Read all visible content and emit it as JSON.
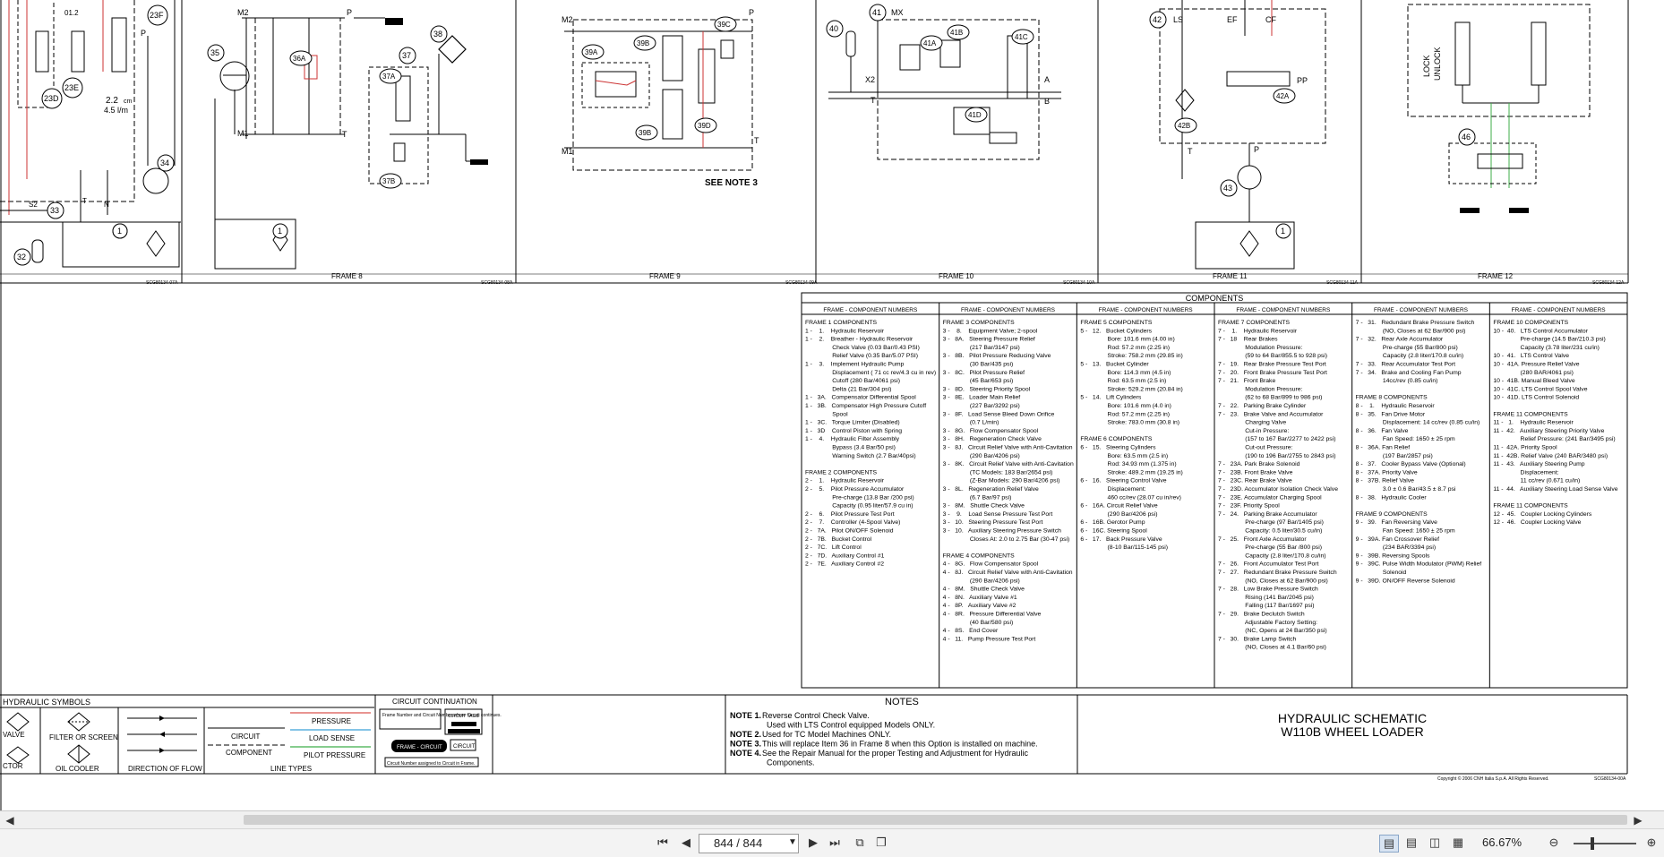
{
  "document": {
    "title_line1": "HYDRAULIC SCHEMATIC",
    "title_line2": "W110B WHEEL LOADER",
    "copyright": "Copyright © 2006 CNH Italia S.p.A. All Rights Reserved.",
    "sheet_code": "SCG80134-00A"
  },
  "frames": [
    {
      "label": "",
      "code": "SCG80134-07A"
    },
    {
      "label": "FRAME 8",
      "code": "SCG80134-08A"
    },
    {
      "label": "FRAME 9",
      "code": "SCG80134-09A"
    },
    {
      "label": "FRAME 10",
      "code": "SCG80134-10A"
    },
    {
      "label": "FRAME 11",
      "code": "SCG80134-11A"
    },
    {
      "label": "FRAME 12",
      "code": "SCG80134-12A"
    }
  ],
  "schematic_labels": {
    "f7": [
      "23F",
      "23E",
      "23D",
      "P",
      "2.2",
      "cm",
      "4.5 l/m",
      "34",
      "33",
      "32",
      "1",
      "S2",
      "T",
      "N",
      "01.2"
    ],
    "f8": [
      "M2",
      "P",
      "36A",
      "35",
      "37",
      "37A",
      "37B",
      "38",
      "M1",
      "T",
      "1"
    ],
    "f9": [
      "M2",
      "39A",
      "39B",
      "39C",
      "39B",
      "39D",
      "M1",
      "P",
      "T",
      "SEE NOTE 3"
    ],
    "f10": [
      "40",
      "41",
      "MX",
      "41A",
      "41B",
      "41C",
      "41D",
      "X2",
      "T",
      "A",
      "B"
    ],
    "f11": [
      "42",
      "LS",
      "EF",
      "CF",
      "42A",
      "42B",
      "PP",
      "T",
      "P",
      "43",
      "1"
    ],
    "f12": [
      "LOCK",
      "UNLOCK",
      "46"
    ]
  },
  "components": {
    "heading": "COMPONENTS",
    "col_header": "FRAME - COMPONENT NUMBERS",
    "columns": [
      [
        "FRAME 1 COMPONENTS",
        "1 -    1.    Hydraulic Reservoir",
        "1 -    2.    Breather - Hydraulic Reservoir",
        "                Check Valve (0.03 Bar/0.43 PSI)",
        "                Relief Valve (0.35 Bar/5.07 PSI)",
        "1 -    3.    Implement Hydraulic Pump",
        "                Displacement ( 71 cc rev/4.3 cu in rev)",
        "                Cutoff (280 Bar/4061 psi)",
        "                Delta (21 Bar/304 psi)",
        "1 -   3A.   Compensator Differential Spool",
        "1 -   3B.   Compensator High Pressure Cutoff",
        "                Spool",
        "1 -   3C.   Torque Limiter (Disabled)",
        "1 -   3D    Control Piston with Spring",
        "1 -    4.    Hydraulic Filter Assembly",
        "                Bypass (3.4 Bar/50 psi)",
        "                Warning Switch (2.7 Bar/40psi)",
        "",
        "FRAME 2 COMPONENTS",
        "2 -    1.    Hydraulic Reservoir",
        "2 -    5.    Pilot Pressure Accumulator",
        "                Pre-charge (13.8 Bar /200 psi)",
        "                Capacity (0.95 liter/57.9 cu in)",
        "2 -    6.    Pilot Pressure Test Port",
        "2 -    7.    Controller (4-Spool Valve)",
        "2 -   7A.   Pilot ON/OFF Solenoid",
        "2 -   7B.   Bucket Control",
        "2 -   7C.   Lift Control",
        "2 -   7D.   Auxiliary Control #1",
        "2 -   7E.   Auxiliary Control #2"
      ],
      [
        "FRAME 3 COMPONENTS",
        "3 -    8.    Equipment Valve; 2-spool",
        "3 -   8A.   Steering Pressure Relief",
        "                (217 Bar/3147 psi)",
        "3 -   8B.   Pilot Pressure Reducing Valve",
        "                (30 Bar/435 psi)",
        "3 -   8C.   Pilot Pressure Relief",
        "                (45 Bar/653 psi)",
        "3 -   8D.   Steering Priority Spool",
        "3 -   8E.   Loader Main Relief",
        "                (227 Bar/3292 psi)",
        "3 -   8F.   Load Sense Bleed Down Orifice",
        "                (0.7 L/min)",
        "3 -   8G.   Flow Compensator Spool",
        "3 -   8H.   Regeneration Check Valve",
        "3 -   8J.   Circuit Relief Valve with Anti-Cavitation",
        "                (290 Bar/4206 psi)",
        "3 -   8K.   Circuit Relief Valve with Anti-Cavitation",
        "                (TC Models: 183 Bar/2654 psi)",
        "                (Z-Bar Models: 290 Bar/4206 psi)",
        "3 -   8L.   Regeneration Relief Valve",
        "                (6.7 Bar/97 psi)",
        "3 -   8M.   Shuttle Check Valve",
        "3 -    9.    Load Sense Pressure Test Port",
        "3 -   10.   Steering Pressure Test Port",
        "3 -   10.   Auxiliary Steering Pressure Switch",
        "                Closes At: 2.0 to 2.75 Bar (30-47 psi)",
        "",
        "FRAME 4 COMPONENTS",
        "4 -   8G.   Flow Compensator Spool",
        "4 -   8J.   Circuit Relief Valve with Anti-Cavitation",
        "                (290 Bar/4206 psi)",
        "4 -   8M.   Shuttle Check Valve",
        "4 -   8N.   Auxiliary Valve #1",
        "4 -   8P.   Auxiliary Valve #2",
        "4 -   8R.   Pressure Differential Valve",
        "                (40 Bar/580 psi)",
        "4 -   8S.   End Cover",
        "4 -   11.   Pump Pressure Test Port"
      ],
      [
        "FRAME 5 COMPONENTS",
        "5 -   12.   Bucket Cylinders",
        "                Bore: 101.6 mm (4.00 in)",
        "                Rod: 57.2 mm (2.25 in)",
        "                Stroke: 758.2 mm (29.85 in)",
        "5 -   13.   Bucket Cylinder",
        "                Bore: 114.3 mm (4.5 in)",
        "                Rod: 63.5 mm (2.5 in)",
        "                Stroke: 529.2 mm (20.84 in)",
        "5 -   14.   Lift Cylinders",
        "                Bore: 101.6 mm (4.0 in)",
        "                Rod: 57.2 mm (2.25 in)",
        "                Stroke: 783.0 mm (30.8 in)",
        "",
        "FRAME 6 COMPONENTS",
        "6 -   15.   Steering Cylinders",
        "                Bore: 63.5 mm (2.5 in)",
        "                Rod: 34.93 mm (1.375 in)",
        "                Stroke: 489.2 mm (19.25 in)",
        "6 -   16.   Steering Control Valve",
        "                Displacement:",
        "                460 cc/rev (28.07 cu in/rev)",
        "6 -   16A. Circuit Relief Valve",
        "                (290 Bar/4206 psi)",
        "6 -   16B. Gerotor Pump",
        "6 -   16C. Steering Spool",
        "6 -   17.   Back Pressure Valve",
        "                (8-10 Bar/115-145 psi)"
      ],
      [
        "FRAME 7 COMPONENTS",
        "7 -    1.    Hydraulic Reservoir",
        "7 -   18    Rear Brakes",
        "                Modulation Pressure:",
        "                (59 to 64 Bar/855.5 to 928 psi)",
        "7 -   19.   Rear Brake Pressure Test Port",
        "7 -   20.   Front Brake Pressure Test Port",
        "7 -   21.   Front Brake",
        "                Modulation Pressure:",
        "                (62 to 68 Bar/899 to 986 psi)",
        "7 -   22.   Parking Brake Cylinder",
        "7 -   23.   Brake Valve and Accumulator",
        "                Charging Valve",
        "                Cut-in Pressure:",
        "                (157 to 167 Bar/2277 to 2422 psi)",
        "                Cut-out Pressure:",
        "                (190 to 196 Bar/2755 to 2843 psi)",
        "7 -   23A. Park Brake Solenoid",
        "7 -   23B. Front Brake Valve",
        "7 -   23C. Rear Brake Valve",
        "7 -   23D. Accumulator Isolation Check Valve",
        "7 -   23E. Accumulator Charging Spool",
        "7 -   23F. Priority Spool",
        "7 -   24.   Parking Brake Accumulator",
        "                Pre-charge (97 Bar/1405 psi)",
        "                Capacity: 0.5 liter/30.5 cu/in)",
        "7 -   25.   Front Axle Accumulator",
        "                Pre-charge (55 Bar /800 psi)",
        "                Capacity (2.8 liter/170.8 cu/in)",
        "7 -   26.   Front Accumulator Test Port",
        "7 -   27.   Redundant Brake Pressure Switch",
        "                (NO, Closes at 62 Bar/900 psi)",
        "7 -   28.   Low Brake Pressure Switch",
        "                Rising (141 Bar/2045 psi)",
        "                Falling (117 Bar/1697 psi)",
        "7 -   29.   Brake Declutch Switch",
        "                Adjustable Factory Setting:",
        "                (NC, Opens at 24 Bar/350 psi)",
        "7 -   30.   Brake Lamp Switch",
        "                (NO, Closes at 4.1 Bar/60 psi)"
      ],
      [
        "7 -   31.   Redundant Brake Pressure Switch",
        "                (NO, Closes at 62 Bar/900 psi)",
        "7 -   32.   Rear Axle Accumulator",
        "                Pre-charge (55 Bar/800 psi)",
        "                Capacity (2.8 liter/170.8 cu/in)",
        "7 -   33.   Rear Accumulator Test Port",
        "7 -   34.   Brake and Cooling Fan Pump",
        "                14cc/rev (0.85 cu/in)",
        "",
        "FRAME 8 COMPONENTS",
        "8 -    1.    Hydraulic Reservoir",
        "8 -   35.   Fan Drive Motor",
        "                Displacement: 14 cc/rev (0.85 cu/in)",
        "8 -   36.   Fan Valve",
        "                Fan Speed: 1650 ± 25 rpm",
        "8 -   36A. Fan Relief",
        "                (197 Bar/2857 psi)",
        "8 -   37.   Cooler Bypass Valve (Optional)",
        "8 -   37A. Priority Valve",
        "8 -   37B. Relief Valve",
        "                3.0 ± 0.6 Bar/43.5 ± 8.7 psi",
        "8 -   38.   Hydraulic Cooler",
        "",
        "FRAME 9 COMPONENTS",
        "9 -   39.   Fan Reversing Valve",
        "                Fan Speed: 1650 ± 25 rpm",
        "9 -   39A. Fan Crossover Relief",
        "                (234 BAR/3394 psi)",
        "9 -   39B. Reversing Spools",
        "9 -   39C. Pulse Width Modulator (PWM) Relief",
        "                Solenoid",
        "9 -   39D. ON/OFF Reverse Solenoid"
      ],
      [
        "FRAME 10 COMPONENTS",
        "10 -  40.   LTS Control Accumulator",
        "                Pre-charge (14.5 Bar/210.3 psi)",
        "                Capacity (3.78 liter/231 cu/in)",
        "10 -  41.   LTS Control Valve",
        "10 -  41A. Pressure Relief Valve",
        "                (280 BAR/4061 psi)",
        "10 -  41B. Manual Bleed Valve",
        "10 -  41C. LTS Control Spool Valve",
        "10 -  41D. LTS Control Solenoid",
        "",
        "FRAME 11 COMPONENTS",
        "11 -   1.    Hydraulic Reservoir",
        "11 -  42.   Auxiliary Steering Priority Valve",
        "                Relief Pressure: (241 Bar/3495 psi)",
        "11 -  42A. Priority Spool",
        "11 -  42B. Relief Valve (240 BAR/3480 psi)",
        "11 -  43.   Auxiliary Steering Pump",
        "                Displacement:",
        "                11 cc/rev (0.671 cu/in)",
        "11 -  44.   Auxiliary Steering Load Sense Valve",
        "",
        "FRAME 11 COMPONENTS",
        "12 -  45.   Coupler Locking Cylinders",
        "12 -  46.   Coupler Locking Valve"
      ]
    ]
  },
  "legend": {
    "title": "HYDRAULIC SYMBOLS",
    "valve": "VALVE",
    "filter": "FILTER OR SCREEN",
    "ctor": "CTOR",
    "oil_cooler": "OIL COOLER",
    "direction": "DIRECTION OF FLOW",
    "line_types": "LINE TYPES",
    "circuit": "CIRCUIT",
    "component": "COMPONENT",
    "pressure": "PRESSURE",
    "load_sense": "LOAD SENSE",
    "pilot_pressure": "PILOT PRESSURE",
    "colors": {
      "pressure": "#d9534f",
      "load_sense": "#3aa0d8",
      "pilot_pressure": "#3fae49"
    }
  },
  "circuit_continuation": {
    "title": "CIRCUIT CONTINUATION",
    "box1": "Frame Number and Circuit Number where Circuit continues.",
    "tags": "CIRCUIT TAGS",
    "frame_circuit": "FRAME - CIRCUIT",
    "circuit": "CIRCUIT",
    "assigned": "Circuit Number assigned to Circuit in Frame."
  },
  "notes": {
    "title": "NOTES",
    "items": [
      {
        "label": "NOTE 1.",
        "text": "Reverse Control Check Valve."
      },
      {
        "label": "",
        "text": "Used with LTS Control equipped Models ONLY."
      },
      {
        "label": "NOTE 2.",
        "text": "Used for TC Model Machines ONLY."
      },
      {
        "label": "NOTE 3.",
        "text": "This will replace Item 36 in Frame 8 when this Option is installed on machine."
      },
      {
        "label": "NOTE 4.",
        "text": "See the Repair Manual for the proper Testing and Adjustment for Hydraulic"
      },
      {
        "label": "",
        "text": "Components."
      }
    ]
  },
  "viewer": {
    "page_value": "844 / 844",
    "zoom": "66.67%",
    "zoom_level": 0.3
  }
}
